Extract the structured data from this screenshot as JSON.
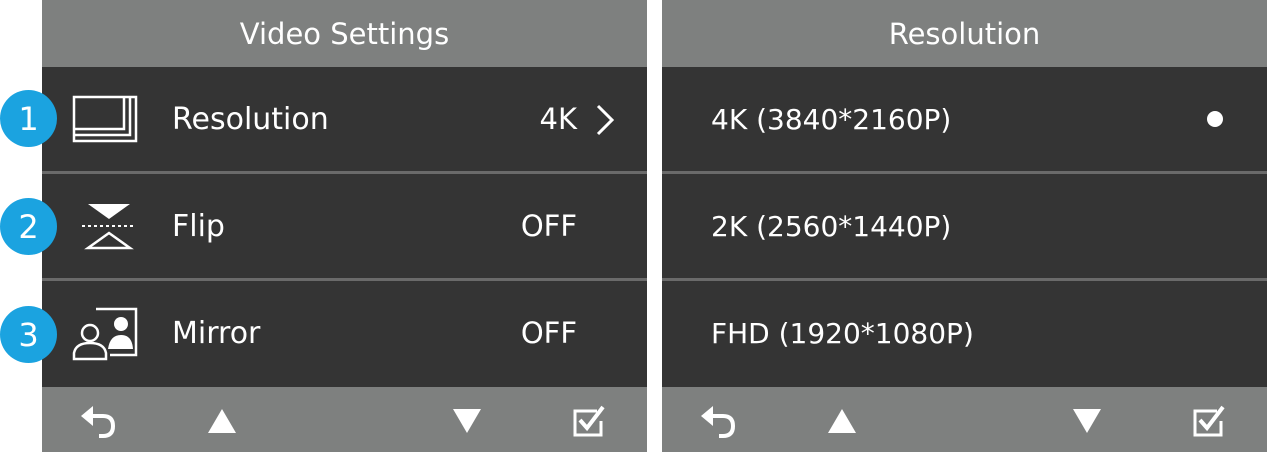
{
  "badges": [
    "1",
    "2",
    "3"
  ],
  "video_settings": {
    "title": "Video Settings",
    "items": [
      {
        "label": "Resolution",
        "value": "4K",
        "icon": "resolution-icon",
        "has_submenu": true
      },
      {
        "label": "Flip",
        "value": "OFF",
        "icon": "flip-icon",
        "has_submenu": false
      },
      {
        "label": "Mirror",
        "value": "OFF",
        "icon": "mirror-icon",
        "has_submenu": false
      }
    ]
  },
  "resolution_menu": {
    "title": "Resolution",
    "options": [
      {
        "label": "4K  (3840*2160P)",
        "selected": true
      },
      {
        "label": "2K  (2560*1440P)",
        "selected": false
      },
      {
        "label": "FHD  (1920*1080P)",
        "selected": false
      }
    ]
  },
  "footer_buttons": [
    "back-icon",
    "arrow-up-icon",
    "arrow-down-icon",
    "confirm-checkbox-icon"
  ],
  "colors": {
    "header_bg": "#7e807f",
    "row_bg": "#343434",
    "separator": "#6a6a6a",
    "badge": "#1ba3e0",
    "text": "#ffffff"
  }
}
